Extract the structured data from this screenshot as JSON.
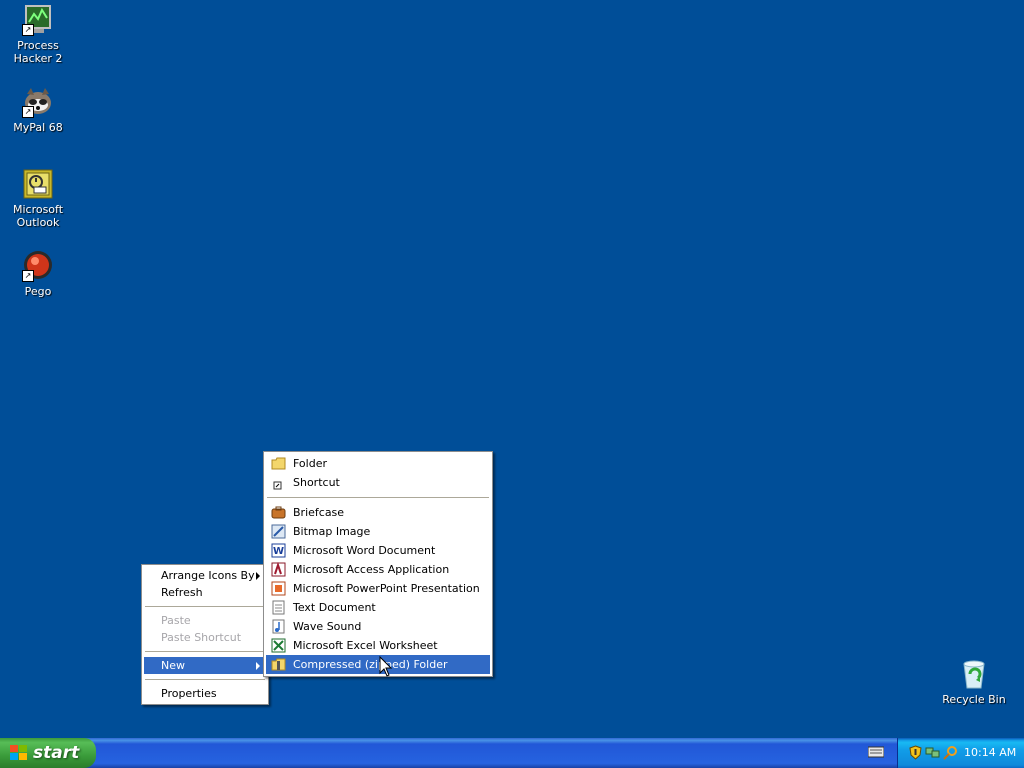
{
  "desktop": {
    "icons": [
      {
        "label": "Process Hacker 2",
        "icon": "process-hacker-icon"
      },
      {
        "label": "MyPal 68",
        "icon": "mypal-icon"
      },
      {
        "label": "Microsoft Outlook",
        "icon": "outlook-icon"
      },
      {
        "label": "Pego",
        "icon": "pego-icon"
      },
      {
        "label": "Recycle Bin",
        "icon": "recycle-bin-icon"
      }
    ],
    "background_color": "#004e98"
  },
  "context_menu": {
    "items": [
      {
        "label": "Arrange Icons By",
        "has_submenu": true
      },
      {
        "label": "Refresh"
      },
      {
        "label": "Paste",
        "disabled": true
      },
      {
        "label": "Paste Shortcut",
        "disabled": true
      },
      {
        "label": "New",
        "has_submenu": true,
        "selected": true
      },
      {
        "label": "Properties"
      }
    ]
  },
  "new_submenu": {
    "items": [
      {
        "label": "Folder",
        "icon": "folder-icon"
      },
      {
        "label": "Shortcut",
        "icon": "shortcut-icon"
      },
      {
        "label": "Briefcase",
        "icon": "briefcase-icon"
      },
      {
        "label": "Bitmap Image",
        "icon": "bitmap-icon"
      },
      {
        "label": "Microsoft Word Document",
        "icon": "word-icon"
      },
      {
        "label": "Microsoft Access Application",
        "icon": "access-icon"
      },
      {
        "label": "Microsoft PowerPoint Presentation",
        "icon": "powerpoint-icon"
      },
      {
        "label": "Text Document",
        "icon": "text-document-icon"
      },
      {
        "label": "Wave Sound",
        "icon": "wave-sound-icon"
      },
      {
        "label": "Microsoft Excel Worksheet",
        "icon": "excel-icon"
      },
      {
        "label": "Compressed (zipped) Folder",
        "icon": "zip-folder-icon",
        "selected": true
      }
    ],
    "highlight_color": "#316ac5"
  },
  "taskbar": {
    "start_label": "start",
    "clock": "10:14 AM",
    "tray_icons": [
      "security-shield-icon",
      "network-icon",
      "search-icon"
    ]
  }
}
